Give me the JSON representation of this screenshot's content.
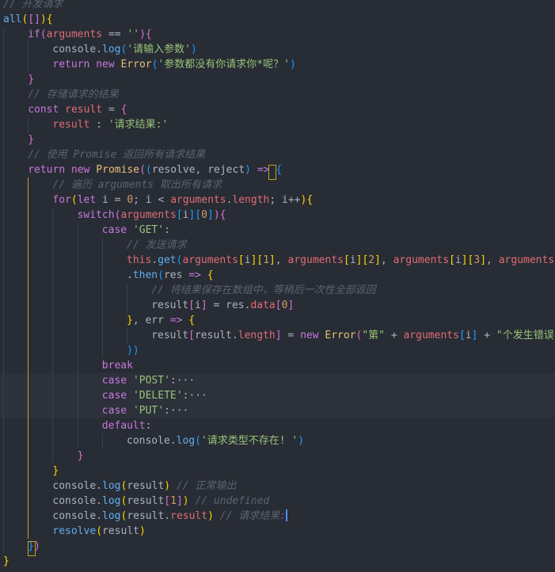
{
  "editor": {
    "theme": "dark",
    "colors": {
      "background": "#282c34",
      "keyword": "#c678dd",
      "function": "#61afef",
      "string": "#98c379",
      "property": "#e06c75",
      "number": "#d19a66",
      "class": "#e5c07b",
      "comment": "#5c6370",
      "active_guide": "#c9a227",
      "cursor": "#528bff"
    },
    "cursor": {
      "line": 34
    },
    "lines": [
      {
        "indent": 0,
        "tokens": [
          [
            "cm",
            "// 开发请求"
          ]
        ]
      },
      {
        "indent": 0,
        "tokens": [
          [
            "fn",
            "all"
          ],
          [
            "br1",
            "("
          ],
          [
            "br2",
            "["
          ],
          [
            "br2",
            "]"
          ],
          [
            "br1",
            ")"
          ],
          [
            "br1",
            "{"
          ]
        ]
      },
      {
        "indent": 1,
        "tokens": [
          [
            "kw",
            "if"
          ],
          [
            "br2",
            "("
          ],
          [
            "prop",
            "arguments"
          ],
          [
            "pl",
            " == "
          ],
          [
            "str",
            "''"
          ],
          [
            "br2",
            ")"
          ],
          [
            "br2",
            "{"
          ]
        ]
      },
      {
        "indent": 2,
        "tokens": [
          [
            "pl",
            "console."
          ],
          [
            "fn",
            "log"
          ],
          [
            "br3",
            "("
          ],
          [
            "str",
            "'请输入参数'"
          ],
          [
            "br3",
            ")"
          ]
        ]
      },
      {
        "indent": 2,
        "tokens": [
          [
            "kw",
            "return"
          ],
          [
            "pl",
            " "
          ],
          [
            "kw",
            "new"
          ],
          [
            "pl",
            " "
          ],
          [
            "cls",
            "Error"
          ],
          [
            "br3",
            "("
          ],
          [
            "str",
            "'参数都没有你请求你*呢？'"
          ],
          [
            "br3",
            ")"
          ]
        ]
      },
      {
        "indent": 1,
        "tokens": [
          [
            "br2",
            "}"
          ]
        ]
      },
      {
        "indent": 1,
        "tokens": [
          [
            "cm",
            "// 存储请求的结果"
          ]
        ]
      },
      {
        "indent": 1,
        "tokens": [
          [
            "kw",
            "const"
          ],
          [
            "pl",
            " "
          ],
          [
            "prop",
            "result"
          ],
          [
            "pl",
            " = "
          ],
          [
            "br2",
            "{"
          ]
        ]
      },
      {
        "indent": 2,
        "tokens": [
          [
            "prop",
            "result"
          ],
          [
            "pl",
            " : "
          ],
          [
            "str",
            "'请求结果:'"
          ]
        ]
      },
      {
        "indent": 1,
        "tokens": [
          [
            "br2",
            "}"
          ]
        ]
      },
      {
        "indent": 1,
        "tokens": [
          [
            "cm",
            "// 使用 Promise 返回所有请求结果"
          ]
        ]
      },
      {
        "indent": 1,
        "tokens": [
          [
            "kw",
            "return"
          ],
          [
            "pl",
            " "
          ],
          [
            "kw",
            "new"
          ],
          [
            "pl",
            " "
          ],
          [
            "cls",
            "Promise"
          ],
          [
            "br2",
            "("
          ],
          [
            "br3",
            "("
          ],
          [
            "pl",
            "resolve, "
          ],
          [
            "pl",
            "reject"
          ],
          [
            "br3",
            ")"
          ],
          [
            "kw",
            " => "
          ],
          [
            "br3",
            "{"
          ]
        ]
      },
      {
        "indent": 2,
        "tokens": [
          [
            "cm",
            "// 遍历 arguments 取出所有请求"
          ]
        ]
      },
      {
        "indent": 2,
        "tokens": [
          [
            "kw",
            "for"
          ],
          [
            "br1",
            "("
          ],
          [
            "kw",
            "let"
          ],
          [
            "pl",
            " i = "
          ],
          [
            "num",
            "0"
          ],
          [
            "pl",
            "; i < "
          ],
          [
            "prop",
            "arguments"
          ],
          [
            "pl",
            "."
          ],
          [
            "prop",
            "length"
          ],
          [
            "pl",
            "; i++"
          ],
          [
            "br1",
            ")"
          ],
          [
            "br1",
            "{"
          ]
        ]
      },
      {
        "indent": 3,
        "tokens": [
          [
            "kw",
            "switch"
          ],
          [
            "br2",
            "("
          ],
          [
            "prop",
            "arguments"
          ],
          [
            "br3",
            "["
          ],
          [
            "pl",
            "i"
          ],
          [
            "br3",
            "]"
          ],
          [
            "br3",
            "["
          ],
          [
            "num",
            "0"
          ],
          [
            "br3",
            "]"
          ],
          [
            "br2",
            ")"
          ],
          [
            "br2",
            "{"
          ]
        ]
      },
      {
        "indent": 4,
        "tokens": [
          [
            "kw",
            "case"
          ],
          [
            "pl",
            " "
          ],
          [
            "str",
            "'GET'"
          ],
          [
            "pl",
            ":"
          ]
        ]
      },
      {
        "indent": 5,
        "tokens": [
          [
            "cm",
            "// 发送请求"
          ]
        ]
      },
      {
        "indent": 5,
        "tokens": [
          [
            "prop",
            "this"
          ],
          [
            "pl",
            "."
          ],
          [
            "fn",
            "get"
          ],
          [
            "br3",
            "("
          ],
          [
            "prop",
            "arguments"
          ],
          [
            "br1",
            "["
          ],
          [
            "pl",
            "i"
          ],
          [
            "br1",
            "]"
          ],
          [
            "br1",
            "["
          ],
          [
            "num",
            "1"
          ],
          [
            "br1",
            "]"
          ],
          [
            "pl",
            ", "
          ],
          [
            "prop",
            "arguments"
          ],
          [
            "br1",
            "["
          ],
          [
            "pl",
            "i"
          ],
          [
            "br1",
            "]"
          ],
          [
            "br1",
            "["
          ],
          [
            "num",
            "2"
          ],
          [
            "br1",
            "]"
          ],
          [
            "pl",
            ", "
          ],
          [
            "prop",
            "arguments"
          ],
          [
            "br1",
            "["
          ],
          [
            "pl",
            "i"
          ],
          [
            "br1",
            "]"
          ],
          [
            "br1",
            "["
          ],
          [
            "num",
            "3"
          ],
          [
            "br1",
            "]"
          ],
          [
            "pl",
            ", "
          ],
          [
            "prop",
            "arguments"
          ],
          [
            "br1",
            "["
          ]
        ]
      },
      {
        "indent": 5,
        "tokens": [
          [
            "pl",
            "."
          ],
          [
            "fn",
            "then"
          ],
          [
            "br3",
            "("
          ],
          [
            "pl",
            "res"
          ],
          [
            "kw",
            " => "
          ],
          [
            "br1",
            "{"
          ]
        ]
      },
      {
        "indent": 6,
        "tokens": [
          [
            "cm",
            "// 将结果保存在数组中，等稍后一次性全部返回"
          ]
        ]
      },
      {
        "indent": 6,
        "tokens": [
          [
            "pl",
            "result"
          ],
          [
            "br2",
            "["
          ],
          [
            "pl",
            "i"
          ],
          [
            "br2",
            "]"
          ],
          [
            "pl",
            " = res."
          ],
          [
            "prop",
            "data"
          ],
          [
            "br2",
            "["
          ],
          [
            "num",
            "0"
          ],
          [
            "br2",
            "]"
          ]
        ]
      },
      {
        "indent": 5,
        "tokens": [
          [
            "br1",
            "}"
          ],
          [
            "pl",
            ", err "
          ],
          [
            "kw",
            "=>"
          ],
          [
            "pl",
            " "
          ],
          [
            "br1",
            "{"
          ]
        ]
      },
      {
        "indent": 6,
        "tokens": [
          [
            "pl",
            "result"
          ],
          [
            "br2",
            "["
          ],
          [
            "pl",
            "result."
          ],
          [
            "prop",
            "length"
          ],
          [
            "br2",
            "]"
          ],
          [
            "pl",
            " = "
          ],
          [
            "kw",
            "new"
          ],
          [
            "pl",
            " "
          ],
          [
            "cls",
            "Error"
          ],
          [
            "br2",
            "("
          ],
          [
            "str",
            "\"第\""
          ],
          [
            "pl",
            " + "
          ],
          [
            "prop",
            "arguments"
          ],
          [
            "br3",
            "["
          ],
          [
            "pl",
            "i"
          ],
          [
            "br3",
            "]"
          ],
          [
            "pl",
            " + "
          ],
          [
            "str",
            "\"个发生错误"
          ]
        ]
      },
      {
        "indent": 5,
        "tokens": [
          [
            "br3",
            ")"
          ],
          [
            "br3",
            ")"
          ]
        ]
      },
      {
        "indent": 4,
        "tokens": [
          [
            "kw",
            "break"
          ]
        ]
      },
      {
        "indent": 4,
        "fold": true,
        "tokens": [
          [
            "kw",
            "case"
          ],
          [
            "pl",
            " "
          ],
          [
            "str",
            "'POST'"
          ],
          [
            "pl",
            ":"
          ],
          [
            "fold",
            "···"
          ]
        ]
      },
      {
        "indent": 4,
        "fold": true,
        "tokens": [
          [
            "kw",
            "case"
          ],
          [
            "pl",
            " "
          ],
          [
            "str",
            "'DELETE'"
          ],
          [
            "pl",
            ":"
          ],
          [
            "fold",
            "···"
          ]
        ]
      },
      {
        "indent": 4,
        "fold": true,
        "tokens": [
          [
            "kw",
            "case"
          ],
          [
            "pl",
            " "
          ],
          [
            "str",
            "'PUT'"
          ],
          [
            "pl",
            ":"
          ],
          [
            "fold",
            "···"
          ]
        ]
      },
      {
        "indent": 4,
        "tokens": [
          [
            "kw",
            "default"
          ],
          [
            "pl",
            ":"
          ]
        ]
      },
      {
        "indent": 5,
        "tokens": [
          [
            "pl",
            "console."
          ],
          [
            "fn",
            "log"
          ],
          [
            "br3",
            "("
          ],
          [
            "str",
            "'请求类型不存在! '"
          ],
          [
            "br3",
            ")"
          ]
        ]
      },
      {
        "indent": 3,
        "tokens": [
          [
            "br2",
            "}"
          ]
        ]
      },
      {
        "indent": 2,
        "tokens": [
          [
            "br1",
            "}"
          ]
        ]
      },
      {
        "indent": 2,
        "tokens": [
          [
            "pl",
            "console."
          ],
          [
            "fn",
            "log"
          ],
          [
            "br1",
            "("
          ],
          [
            "pl",
            "result"
          ],
          [
            "br1",
            ")"
          ],
          [
            "pl",
            " "
          ],
          [
            "cm",
            "// 正常输出"
          ]
        ]
      },
      {
        "indent": 2,
        "tokens": [
          [
            "pl",
            "console."
          ],
          [
            "fn",
            "log"
          ],
          [
            "br1",
            "("
          ],
          [
            "pl",
            "result"
          ],
          [
            "br2",
            "["
          ],
          [
            "num",
            "1"
          ],
          [
            "br2",
            "]"
          ],
          [
            "br1",
            ")"
          ],
          [
            "pl",
            " "
          ],
          [
            "cm",
            "// undefined"
          ]
        ]
      },
      {
        "indent": 2,
        "tokens": [
          [
            "pl",
            "console."
          ],
          [
            "fn",
            "log"
          ],
          [
            "br1",
            "("
          ],
          [
            "pl",
            "result."
          ],
          [
            "prop",
            "result"
          ],
          [
            "br1",
            ")"
          ],
          [
            "pl",
            " "
          ],
          [
            "cm",
            "// 请求结果:"
          ]
        ]
      },
      {
        "indent": 2,
        "tokens": [
          [
            "fn",
            "resolve"
          ],
          [
            "br1",
            "("
          ],
          [
            "pl",
            "result"
          ],
          [
            "br1",
            ")"
          ]
        ]
      },
      {
        "indent": 1,
        "tokens": [
          [
            "br3",
            "}"
          ],
          [
            "br2",
            ")"
          ]
        ]
      },
      {
        "indent": 0,
        "tokens": [
          [
            "br1",
            "}"
          ]
        ]
      }
    ]
  }
}
